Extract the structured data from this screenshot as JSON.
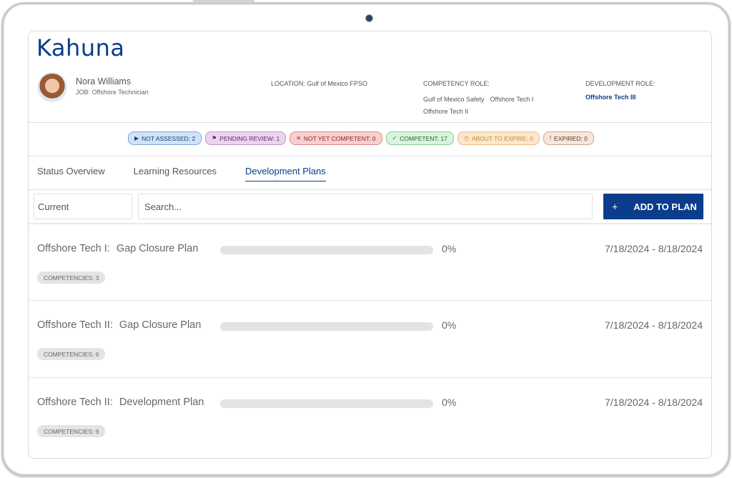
{
  "app": {
    "logo": "Kahuna"
  },
  "profile": {
    "name": "Nora Williams",
    "job": "JOB: Offshore Technician",
    "location": "LOCATION: Gulf of Mexico FPSO",
    "competency_role_label": "COMPETENCY ROLE:",
    "competency_roles": [
      "Gulf of Mexico Safety",
      "Offshore Tech I",
      "Offshore Tech II"
    ],
    "development_role_label": "DEVELOPMENT ROLE:",
    "development_role": "Offshore Tech III"
  },
  "status_badges": [
    {
      "icon": "play-icon",
      "glyph": "▶",
      "label": "NOT ASSESSED: 2",
      "bg": "#cfe2f7",
      "border": "#7fa9d9",
      "color": "#1d3f73"
    },
    {
      "icon": "flag-icon",
      "glyph": "⚑",
      "label": "PENDING REVIEW: 1",
      "bg": "#ecd3ef",
      "border": "#c594cc",
      "color": "#5b2a63"
    },
    {
      "icon": "x-icon",
      "glyph": "✕",
      "label": "NOT YET COMPETENT: 0",
      "bg": "#f7cfcf",
      "border": "#dc8b8b",
      "color": "#8a2323"
    },
    {
      "icon": "check-icon",
      "glyph": "✓",
      "label": "COMPETENT: 17",
      "bg": "#d9f3dc",
      "border": "#8ccc95",
      "color": "#1f6b2a"
    },
    {
      "icon": "clock-icon",
      "glyph": "◷",
      "label": "ABOUT TO EXPIRE: 0",
      "bg": "#fbe7cc",
      "border": "#e9bf85",
      "color": "#c88a2e"
    },
    {
      "icon": "exclamation-icon",
      "glyph": "!",
      "label": "EXPIRED: 0",
      "bg": "#f6e6da",
      "border": "#c9a78f",
      "color": "#5a3a26"
    }
  ],
  "tabs": [
    {
      "label": "Status Overview",
      "active": false
    },
    {
      "label": "Learning Resources",
      "active": false
    },
    {
      "label": "Development Plans",
      "active": true
    }
  ],
  "toolbar": {
    "filter_value": "Current",
    "search_placeholder": "Search...",
    "add_icon": "+",
    "add_label": "ADD TO PLAN"
  },
  "plans": [
    {
      "role": "Offshore Tech I:",
      "name": "Gap Closure Plan",
      "progress": 0,
      "progress_label": "0%",
      "dates": "7/18/2024 - 8/18/2024",
      "competencies": "COMPETENCIES: 3"
    },
    {
      "role": "Offshore Tech II:",
      "name": "Gap Closure Plan",
      "progress": 0,
      "progress_label": "0%",
      "dates": "7/18/2024 - 8/18/2024",
      "competencies": "COMPETENCIES: 6"
    },
    {
      "role": "Offshore Tech II:",
      "name": "Development Plan",
      "progress": 0,
      "progress_label": "0%",
      "dates": "7/18/2024 - 8/18/2024",
      "competencies": "COMPETENCIES: 9"
    }
  ]
}
